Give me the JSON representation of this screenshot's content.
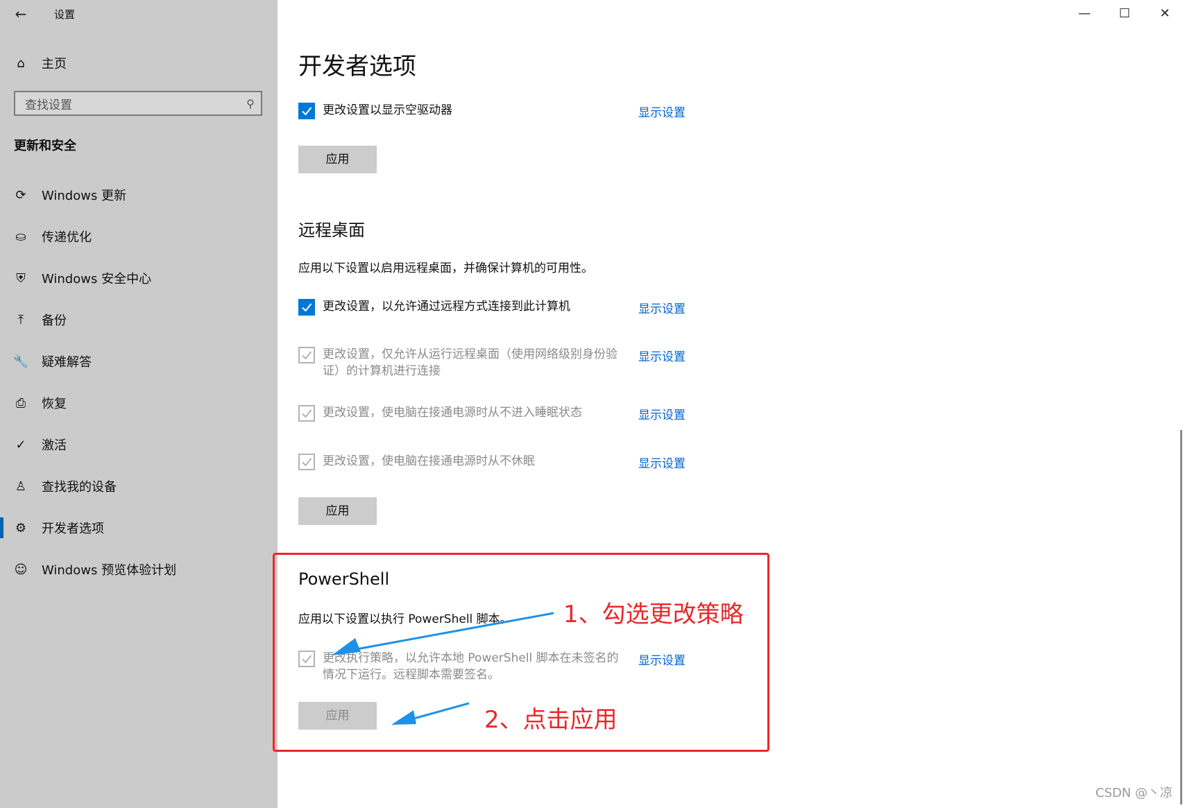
{
  "window": {
    "title": "设置",
    "back_icon": "←"
  },
  "sidebar": {
    "home_label": "主页",
    "search_placeholder": "查找设置",
    "section_title": "更新和安全",
    "items": [
      {
        "label": "Windows 更新",
        "icon": "sync-icon",
        "glyph": "⟳"
      },
      {
        "label": "传递优化",
        "icon": "delivery-icon",
        "glyph": "⛀"
      },
      {
        "label": "Windows 安全中心",
        "icon": "shield-icon",
        "glyph": "⛨"
      },
      {
        "label": "备份",
        "icon": "backup-icon",
        "glyph": "⤒"
      },
      {
        "label": "疑难解答",
        "icon": "wrench-icon",
        "glyph": "🔧"
      },
      {
        "label": "恢复",
        "icon": "recovery-icon",
        "glyph": "⎙"
      },
      {
        "label": "激活",
        "icon": "check-circle-icon",
        "glyph": "✓"
      },
      {
        "label": "查找我的设备",
        "icon": "person-pin-icon",
        "glyph": "♙"
      },
      {
        "label": "开发者选项",
        "icon": "developer-icon",
        "glyph": "⚙",
        "active": true
      },
      {
        "label": "Windows 预览体验计划",
        "icon": "insider-icon",
        "glyph": "☺"
      }
    ]
  },
  "main": {
    "title": "开发者选项",
    "show_settings_label": "显示设置",
    "apply_label": "应用",
    "drives": {
      "option": "更改设置以显示空驱动器",
      "checked": true
    },
    "remote": {
      "heading": "远程桌面",
      "description": "应用以下设置以启用远程桌面，并确保计算机的可用性。",
      "options": [
        {
          "label": "更改设置，以允许通过远程方式连接到此计算机",
          "checked": true,
          "enabled": true
        },
        {
          "label": "更改设置，仅允许从运行远程桌面（使用网络级别身份验证）的计算机进行连接",
          "checked": true,
          "enabled": false
        },
        {
          "label": "更改设置，使电脑在接通电源时从不进入睡眠状态",
          "checked": true,
          "enabled": false
        },
        {
          "label": "更改设置，使电脑在接通电源时从不休眠",
          "checked": true,
          "enabled": false
        }
      ]
    },
    "powershell": {
      "heading": "PowerShell",
      "description": "应用以下设置以执行 PowerShell 脚本。",
      "option": "更改执行策略，以允许本地 PowerShell 脚本在未签名的情况下运行。远程脚本需要签名。",
      "checked": true,
      "enabled": false
    }
  },
  "annotations": {
    "step1": "1、勾选更改策略",
    "step2": "2、点击应用",
    "accent_red": "#e8282b",
    "arrow_blue": "#1e90e8"
  },
  "watermark": "CSDN @丶凉"
}
